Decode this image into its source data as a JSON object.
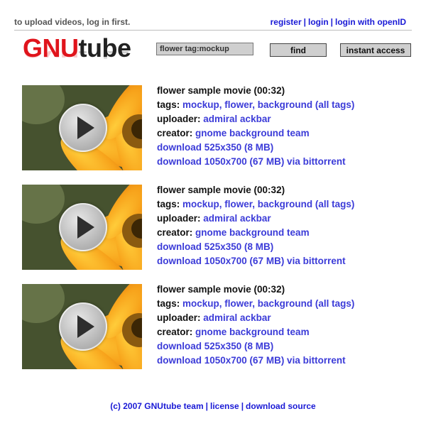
{
  "header": {
    "notice": "to upload videos, log in first.",
    "links": [
      "register",
      "login",
      "login with openID"
    ],
    "separator": "|"
  },
  "logo": {
    "part1": "GNU",
    "part2": "tube"
  },
  "search": {
    "value": "flower tag:mockup",
    "find_label": "find",
    "instant_label": "instant access"
  },
  "videos": [
    {
      "title": "flower sample movie (00:32)",
      "tags_label": "tags:",
      "tags": "mockup, flower, background",
      "all_tags": "(all tags)",
      "uploader_label": "uploader:",
      "uploader": "admiral ackbar",
      "creator_label": "creator:",
      "creator": "gnome background team",
      "download_small": "download 525x350 (8 MB)",
      "download_large": "download 1050x700 (67 MB) via bittorrent"
    },
    {
      "title": "flower sample movie (00:32)",
      "tags_label": "tags:",
      "tags": "mockup, flower, background",
      "all_tags": "(all tags)",
      "uploader_label": "uploader:",
      "uploader": "admiral ackbar",
      "creator_label": "creator:",
      "creator": "gnome background team",
      "download_small": "download 525x350 (8 MB)",
      "download_large": "download 1050x700 (67 MB) via bittorrent"
    },
    {
      "title": "flower sample movie (00:32)",
      "tags_label": "tags:",
      "tags": "mockup, flower, background",
      "all_tags": "(all tags)",
      "uploader_label": "uploader:",
      "uploader": "admiral ackbar",
      "creator_label": "creator:",
      "creator": "gnome background team",
      "download_small": "download 525x350 (8 MB)",
      "download_large": "download 1050x700 (67 MB) via bittorrent"
    }
  ],
  "footer": {
    "copyright": "(c) 2007 GNUtube team",
    "license": "license",
    "source": "download source",
    "separator": "|"
  },
  "colors": {
    "link": "#1a1ad6",
    "logo_red": "#e0141c",
    "text": "#111111"
  },
  "icons": [
    "play-icon"
  ]
}
